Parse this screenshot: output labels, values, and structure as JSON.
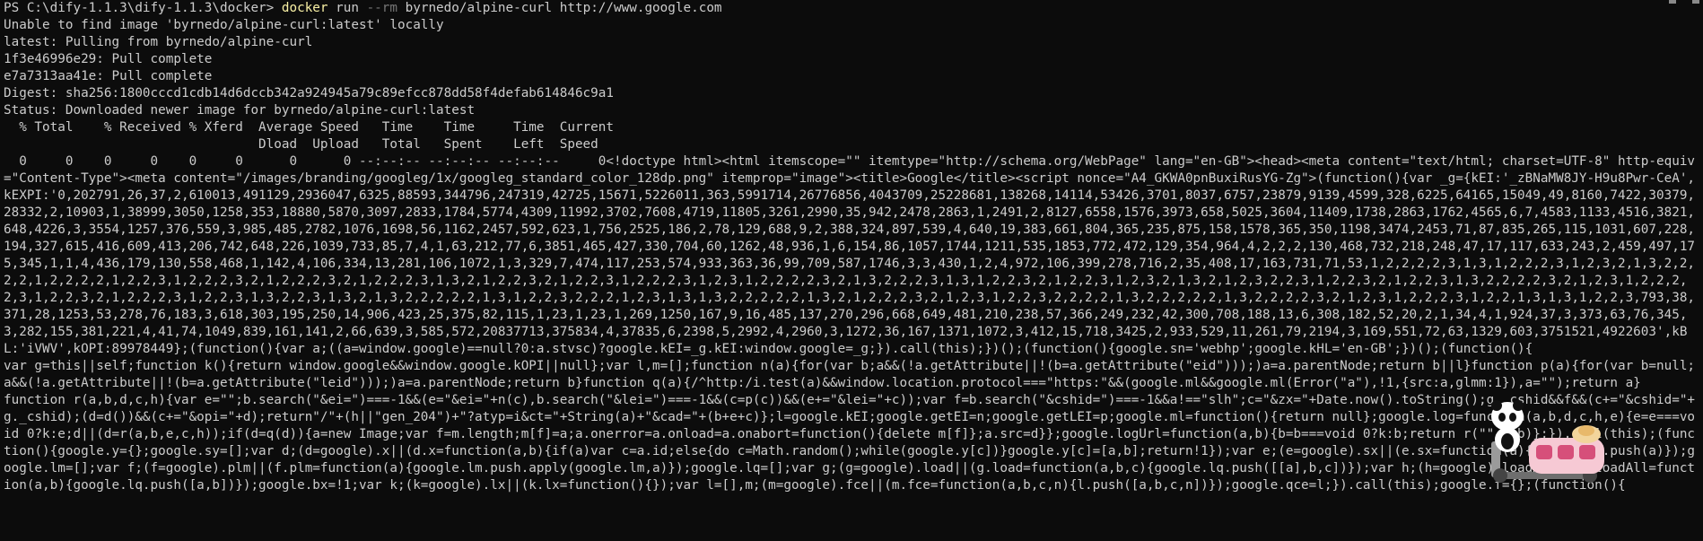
{
  "terminal": {
    "prompt": "PS C:\\dify-1.1.3\\dify-1.1.3\\docker> ",
    "command_word": "docker",
    "command_rest_1": " run ",
    "command_flag": "--rm",
    "command_rest_2": " byrnedo/alpine-curl http://www.google.com",
    "lines": [
      "Unable to find image 'byrnedo/alpine-curl:latest' locally",
      "latest: Pulling from byrnedo/alpine-curl",
      "1f3e46996e29: Pull complete",
      "e7a7313aa41e: Pull complete",
      "Digest: sha256:1800cccd1cdb14d6dccb342a924945a79c89efcc878dd58f4defab614846c9a1",
      "Status: Downloaded newer image for byrnedo/alpine-curl:latest",
      "  % Total    % Received % Xferd  Average Speed   Time    Time     Time  Current",
      "                                 Dload  Upload   Total   Spent    Left  Speed"
    ],
    "curl_output": "  0     0    0     0    0     0      0      0 --:--:-- --:--:-- --:--:--     0<!doctype html><html itemscope=\"\" itemtype=\"http://schema.org/WebPage\" lang=\"en-GB\"><head><meta content=\"text/html; charset=UTF-8\" http-equiv=\"Content-Type\"><meta content=\"/images/branding/googleg/1x/googleg_standard_color_128dp.png\" itemprop=\"image\"><title>Google</title><script nonce=\"A4_GKWA0pnBuxiRusYG-Zg\">(function(){var _g={kEI:'_zBNaMW8JY-H9u8Pwr-CeA',kEXPI:'0,202791,26,37,2,610013,491129,2936047,6325,88593,344796,247319,42725,15671,5226011,363,5991714,26776856,4043709,25228681,138268,14114,53426,3701,8037,6757,23879,9139,4599,328,6225,64165,15049,49,8160,7422,30379,28332,2,10903,1,38999,3050,1258,353,18880,5870,3097,2833,1784,5774,4309,11992,3702,7608,4719,11805,3261,2990,35,942,2478,2863,1,2491,2,8127,6558,1576,3973,658,5025,3604,11409,1738,2863,1762,4565,6,7,4583,1133,4516,3821,648,4226,3,3554,1257,376,559,3,985,485,2782,1076,1698,56,1162,2457,592,623,1,756,2525,186,2,78,129,688,9,2,388,324,897,539,4,640,19,383,661,804,365,235,875,158,1578,365,350,1198,3474,2453,71,87,835,265,115,1031,607,228,194,327,615,416,609,413,206,742,648,226,1039,733,85,7,4,1,63,212,77,6,3851,465,427,330,704,60,1262,48,936,1,6,154,86,1057,1744,1211,535,1853,772,472,129,354,964,4,2,2,2,130,468,732,218,248,47,17,117,633,243,2,459,497,175,345,1,1,4,436,179,130,558,468,1,142,4,106,334,13,281,106,1072,1,3,329,7,474,117,253,574,933,363,36,99,709,587,1746,3,3,430,1,2,4,972,106,399,278,716,2,35,408,17,163,731,71,53,1,2,2,2,2,3,1,3,1,2,2,2,3,1,2,3,2,1,3,2,2,2,2,1,2,2,2,2,1,2,2,3,1,2,2,2,3,2,1,2,2,2,3,2,1,2,2,2,3,1,3,2,1,2,2,3,2,1,2,2,3,1,2,2,2,3,1,2,3,1,2,2,2,2,3,2,1,3,2,2,2,3,1,3,1,2,2,3,2,1,2,2,3,1,2,3,2,1,3,2,1,2,3,2,2,3,1,2,2,3,2,1,2,2,3,1,3,2,2,2,2,3,2,1,2,3,1,2,2,2,2,3,1,2,2,3,2,1,2,2,2,3,1,2,2,3,1,3,2,2,3,1,3,2,1,3,2,2,2,2,2,1,3,1,2,2,3,2,2,2,1,2,3,1,3,1,3,2,2,2,2,2,1,3,2,1,2,2,2,3,2,1,2,3,1,2,2,3,2,2,2,2,1,3,2,2,2,2,2,1,3,2,2,2,2,3,2,1,2,3,1,2,2,2,3,1,2,2,1,3,1,3,1,2,2,3,793,38,371,28,1253,53,278,76,183,3,618,303,195,250,14,906,423,25,375,82,115,1,23,1,23,1,269,1250,167,9,16,485,137,270,296,668,649,481,210,238,57,366,249,232,42,300,708,188,13,6,308,182,52,20,2,1,34,4,1,924,37,3,373,63,76,345,3,282,155,381,221,4,41,74,1049,839,161,141,2,66,639,3,585,572,20837713,375834,4,37835,6,2398,5,2992,4,2960,3,1272,36,167,1371,1072,3,412,15,718,3425,2,933,529,11,261,79,2194,3,169,551,72,63,1329,603,3751521,4922603',kBL:'iVWV',kOPI:89978449};(function(){var a;((a=window.google)==null?0:a.stvsc)?google.kEI=_g.kEI:window.google=_g;}).call(this);})();(function(){google.sn='webhp';google.kHL='en-GB';})();(function(){\nvar g=this||self;function k(){return window.google&&window.google.kOPI||null};var l,m=[];function n(a){for(var b;a&&(!a.getAttribute||!(b=a.getAttribute(\"eid\")));)a=a.parentNode;return b||l}function p(a){for(var b=null;a&&(!a.getAttribute||!(b=a.getAttribute(\"leid\")));)a=a.parentNode;return b}function q(a){/^http:/i.test(a)&&window.location.protocol===\"https:\"&&(google.ml&&google.ml(Error(\"a\"),!1,{src:a,glmm:1}),a=\"\");return a}\nfunction r(a,b,d,c,h){var e=\"\";b.search(\"&ei=\")===-1&&(e=\"&ei=\"+n(c),b.search(\"&lei=\")===-1&&(c=p(c))&&(e+=\"&lei=\"+c));var f=b.search(\"&cshid=\")===-1&&a!==\"slh\";c=\"&zx=\"+Date.now().toString();g._cshid&&f&&(c+=\"&cshid=\"+g._cshid);(d=d())&&(c+=\"&opi=\"+d);return\"/\"+(h||\"gen_204\")+\"?atyp=i&ct=\"+String(a)+\"&cad=\"+(b+e+c)};l=google.kEI;google.getEI=n;google.getLEI=p;google.ml=function(){return null};google.log=function(a,b,d,c,h,e){e=e===void 0?k:e;d||(d=r(a,b,e,c,h));if(d=q(d)){a=new Image;var f=m.length;m[f]=a;a.onerror=a.onload=a.onabort=function(){delete m[f]};a.src=d}};google.logUrl=function(a,b){b=b===void 0?k:b;return r(\"\",a,b)};}).call(this);(function(){google.y={};google.sy=[];var d;(d=google).x||(d.x=function(a,b){if(a)var c=a.id;else{do c=Math.random();while(google.y[c])}google.y[c]=[a,b];return!1});var e;(e=google).sx||(e.sx=function(a){google.sy.push(a)});google.lm=[];var f;(f=google).plm||(f.plm=function(a){google.lm.push.apply(google.lm,a)});google.lq=[];var g;(g=google).load||(g.load=function(a,b,c){google.lq.push([[a],b,c])});var h;(h=google).loadAll||(h.loadAll=function(a,b){google.lq.push([a,b])});google.bx=!1;var k;(k=google).lx||(k.lx=function(){});var l=[],m;(m=google).fce||(m.fce=function(a,b,c,n){l.push([a,b,c,n])});google.qce=l;}).call(this);google.f={};(function(){"
  },
  "colors": {
    "background": "#0c0c0c",
    "text": "#cccccc",
    "command": "#f9f1a5",
    "flag": "#767676"
  },
  "icons": {
    "mascot": "panda-scooter-icon"
  }
}
